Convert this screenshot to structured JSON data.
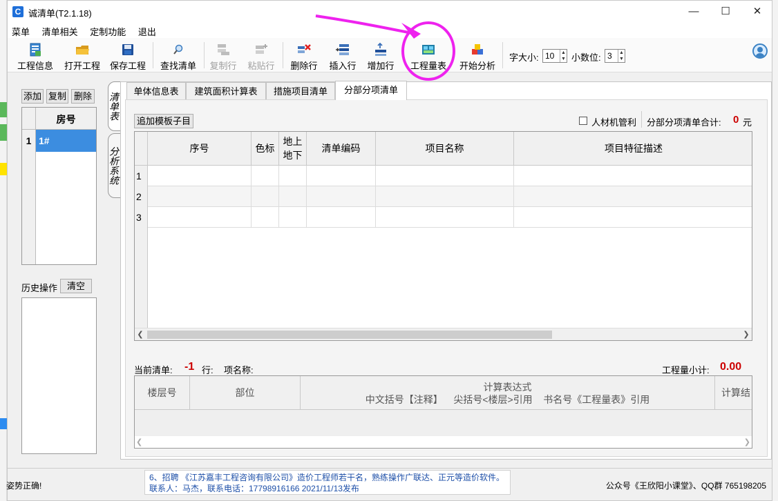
{
  "window": {
    "title": "诚清单(T2.1.18)",
    "app_icon_letter": "C"
  },
  "menu": [
    "菜单",
    "清单相关",
    "定制功能",
    "退出"
  ],
  "toolbar": {
    "buttons": [
      {
        "label": "工程信息",
        "icon": "project-info-icon",
        "enabled": true
      },
      {
        "label": "打开工程",
        "icon": "folder-open-icon",
        "enabled": true
      },
      {
        "label": "保存工程",
        "icon": "save-disk-icon",
        "enabled": true
      },
      {
        "label": "查找清单",
        "icon": "search-icon",
        "enabled": true
      },
      {
        "label": "复制行",
        "icon": "copy-row-icon",
        "enabled": false
      },
      {
        "label": "粘贴行",
        "icon": "paste-row-icon",
        "enabled": false
      },
      {
        "label": "删除行",
        "icon": "delete-row-icon",
        "enabled": true
      },
      {
        "label": "插入行",
        "icon": "insert-row-icon",
        "enabled": true
      },
      {
        "label": "增加行",
        "icon": "add-row-icon",
        "enabled": true
      },
      {
        "label": "工程量表",
        "icon": "quantity-table-icon",
        "enabled": true
      },
      {
        "label": "开始分析",
        "icon": "analysis-cubes-icon",
        "enabled": true
      }
    ],
    "font_size_label": "字大小:",
    "font_size_value": "10",
    "decimals_label": "小数位:",
    "decimals_value": "3"
  },
  "left_panel": {
    "add": "添加",
    "copy": "复制",
    "delete": "删除",
    "house_header": "房号",
    "rows": [
      {
        "num": "1",
        "house": "1#"
      }
    ],
    "history_label": "历史操作",
    "clear": "清空"
  },
  "side_tabs": [
    "清单表",
    "分析系统"
  ],
  "tabs": [
    "单体信息表",
    "建筑面积计算表",
    "措施项目清单",
    "分部分项清单"
  ],
  "active_tab_index": 3,
  "bill_section": {
    "add_template": "追加模板子目",
    "labor_checkbox": "人材机管利",
    "total_label": "分部分项清单合计:",
    "total_value": "0",
    "total_unit": "元",
    "columns": [
      "序号",
      "色标",
      "地上\n地下",
      "清单编码",
      "项目名称",
      "项目特征描述"
    ],
    "row_numbers": [
      "1",
      "2",
      "3"
    ]
  },
  "calc_section": {
    "current_label": "当前清单:",
    "current_value": "-1",
    "row_label": "行:",
    "item_label": "项名称:",
    "subtotal_label": "工程量小计:",
    "subtotal_value": "0.00",
    "col_floor": "楼层号",
    "col_part": "部位",
    "col_expr_title": "计算表达式",
    "col_expr_hint": "中文括号【注释】    尖括号<楼层>引用    书名号《工程量表》引用",
    "col_result": "计算结"
  },
  "status": {
    "left": "姿势正确!",
    "ad_line1": "6、招聘 《江苏嘉丰工程咨询有限公司》造价工程师若干名，熟练操作广联达、正元等造价软件。",
    "ad_line2": "联系人：马杰，联系电话：17798916166  2021/11/13发布",
    "right": "公众号《王欣阳小课堂》、QQ群 765198205"
  },
  "colors": {
    "selected": "#3c8de0",
    "accent_red": "#cc0000",
    "annotation": "#ee22ee",
    "ad_text": "#1d4fa8"
  }
}
